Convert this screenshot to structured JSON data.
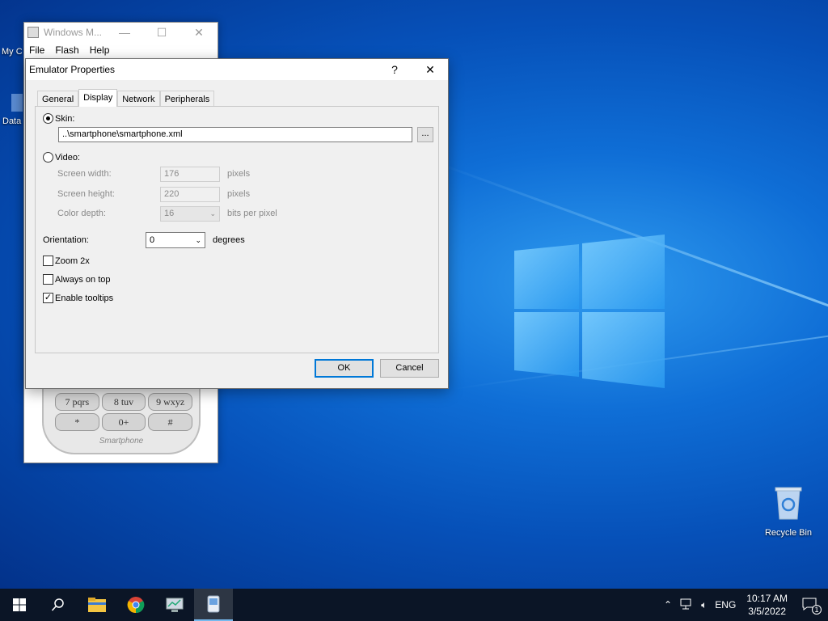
{
  "desktop": {
    "recycle_bin_label": "Recycle Bin",
    "left_icons": [
      {
        "label": "My C",
        "icon": "computer-icon"
      },
      {
        "label": "Data",
        "icon": "shortcut-icon"
      }
    ]
  },
  "wm_window": {
    "title": "Windows M...",
    "menu": [
      "File",
      "Flash",
      "Help"
    ],
    "keys": [
      "7 pqrs",
      "8 tuv",
      "9 wxyz",
      "*",
      "0+",
      "#"
    ],
    "brand": "Smartphone"
  },
  "dialog": {
    "title": "Emulator Properties",
    "help_btn": "?",
    "close_btn": "✕",
    "tabs": [
      "General",
      "Display",
      "Network",
      "Peripherals"
    ],
    "active_tab": "Display",
    "skin": {
      "label": "Skin:",
      "value": "..\\smartphone\\smartphone.xml",
      "browse": "...",
      "selected": true
    },
    "video": {
      "label": "Video:",
      "selected": false,
      "screen_width_label": "Screen width:",
      "screen_width": "176",
      "screen_height_label": "Screen height:",
      "screen_height": "220",
      "color_depth_label": "Color depth:",
      "color_depth": "16",
      "pixels_unit": "pixels",
      "bpp_unit": "bits per pixel"
    },
    "orientation": {
      "label": "Orientation:",
      "value": "0",
      "unit": "degrees"
    },
    "checks": [
      {
        "label": "Zoom 2x",
        "checked": false
      },
      {
        "label": "Always on top",
        "checked": false
      },
      {
        "label": "Enable tooltips",
        "checked": true
      }
    ],
    "ok_label": "OK",
    "cancel_label": "Cancel"
  },
  "taskbar": {
    "language": "ENG",
    "time": "10:17 AM",
    "date": "3/5/2022",
    "notification_count": "1"
  },
  "colors": {
    "accent": "#0078d7",
    "taskbar": "#0b1526"
  }
}
